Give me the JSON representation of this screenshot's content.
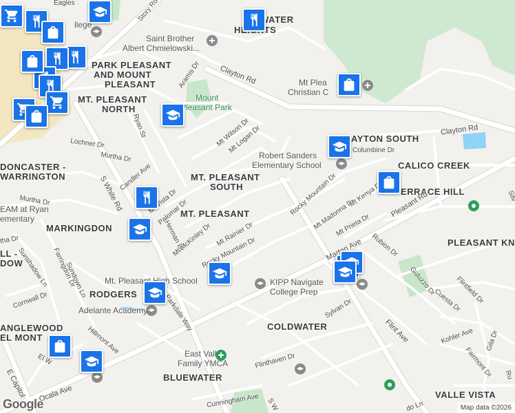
{
  "map": {
    "attribution": "Map data ©2026",
    "logo": "Google",
    "colors": {
      "background": "#f2f1ee",
      "road": "#ffffff",
      "road_outline": "#d8d6d0",
      "park": "#c8e6c9",
      "water": "#8fd3f5",
      "commercial": "#f3e7c2",
      "marker": "#1a73e8"
    }
  },
  "neighborhoods": [
    {
      "text": "PARK PLEASANT"
    },
    {
      "text": "AND MOUNT"
    },
    {
      "text": "PLEASANT"
    },
    {
      "text": "MT. PLEASANT"
    },
    {
      "text": "NORTH"
    },
    {
      "text": "MT. PLEASANT"
    },
    {
      "text": "SOUTH"
    },
    {
      "text": "MT. PLEASANT"
    },
    {
      "text": "MARKINGDON"
    },
    {
      "text": "DONCASTER -"
    },
    {
      "text": "WARRINGTON"
    },
    {
      "text": "RODGERS"
    },
    {
      "text": "COLDWATER"
    },
    {
      "text": "BLUEWATER"
    },
    {
      "text": "CALICO CREEK"
    },
    {
      "text": "ERRACE HILL"
    },
    {
      "text": "PLEASANT KN"
    },
    {
      "text": "VALLE VISTA"
    },
    {
      "text": "AYTON SOUTH"
    },
    {
      "text": "WATER"
    },
    {
      "text": "HEIGHTS"
    },
    {
      "text": "ANGLEWOOD"
    },
    {
      "text": "EL MONT"
    },
    {
      "text": "LL -"
    },
    {
      "text": "DOW"
    }
  ],
  "streets": [
    {
      "text": "Story Rd"
    },
    {
      "text": "Clayton Rd"
    },
    {
      "text": "Clayton Rd"
    },
    {
      "text": "Aramis Dr"
    },
    {
      "text": "Mt Wilson Dr"
    },
    {
      "text": "Mt Logan Dr"
    },
    {
      "text": "Ryan St"
    },
    {
      "text": "Lochner Dr"
    },
    {
      "text": "Murtha Dr"
    },
    {
      "text": "Murtha Dr"
    },
    {
      "text": "Candler Ave"
    },
    {
      "text": "S White Rd"
    },
    {
      "text": "Palomar Dr"
    },
    {
      "text": "Mt McKinley Dr"
    },
    {
      "text": "Mt Rainier Dr"
    },
    {
      "text": "Rocky Mountain Dr"
    },
    {
      "text": "Rocky Mountain Dr"
    },
    {
      "text": "Mt Madonna Dr"
    },
    {
      "text": "Mt Kenya Dr"
    },
    {
      "text": "Mt Prieta Dr"
    },
    {
      "text": "Pleasant Rd"
    },
    {
      "text": "Marten Ave"
    },
    {
      "text": "Rubion Dr"
    },
    {
      "text": "Columbine Dr"
    },
    {
      "text": "Guluzzo Dr"
    },
    {
      "text": "Flintfield Dr"
    },
    {
      "text": "Cuesta Dr"
    },
    {
      "text": "Kohler Ave"
    },
    {
      "text": "Fairmont Dr"
    },
    {
      "text": "Gila Dr"
    },
    {
      "text": "Flint Ave"
    },
    {
      "text": "Sylvan Dr"
    },
    {
      "text": "Flinthaven Dr"
    },
    {
      "text": "Cunningham Ave"
    },
    {
      "text": "Parkdale Way"
    },
    {
      "text": "Sunshadow Ln"
    },
    {
      "text": "Farringdon Dr"
    },
    {
      "text": "Sundown Ln"
    },
    {
      "text": "Cornwall Dr"
    },
    {
      "text": "Hillmont Ave"
    },
    {
      "text": "Ocala Ave"
    },
    {
      "text": "E Capitol"
    },
    {
      "text": "Eagles"
    },
    {
      "text": "El W"
    },
    {
      "text": "Silv"
    },
    {
      "text": "Ru"
    },
    {
      "text": "do Ln"
    },
    {
      "text": "S W"
    },
    {
      "text": "tha Dr"
    },
    {
      "text": "Herman Dr"
    },
    {
      "text": "Mt Vista Dr"
    }
  ],
  "places": [
    {
      "text": "Saint Brother"
    },
    {
      "text": "Albert Chmielowski..."
    },
    {
      "text": "Mount"
    },
    {
      "text": "Pleasant Park"
    },
    {
      "text": "Robert Sanders"
    },
    {
      "text": "Elementary School"
    },
    {
      "text": "Mt Plea"
    },
    {
      "text": "Christian C"
    },
    {
      "text": "EAM at Ryan"
    },
    {
      "text": "ementary"
    },
    {
      "text": "Mt. Pleasant High School"
    },
    {
      "text": "Adelante Academy"
    },
    {
      "text": "KIPP Navigate"
    },
    {
      "text": "College Prep"
    },
    {
      "text": "East Valley"
    },
    {
      "text": "Family YMCA"
    },
    {
      "text": "llege"
    }
  ]
}
